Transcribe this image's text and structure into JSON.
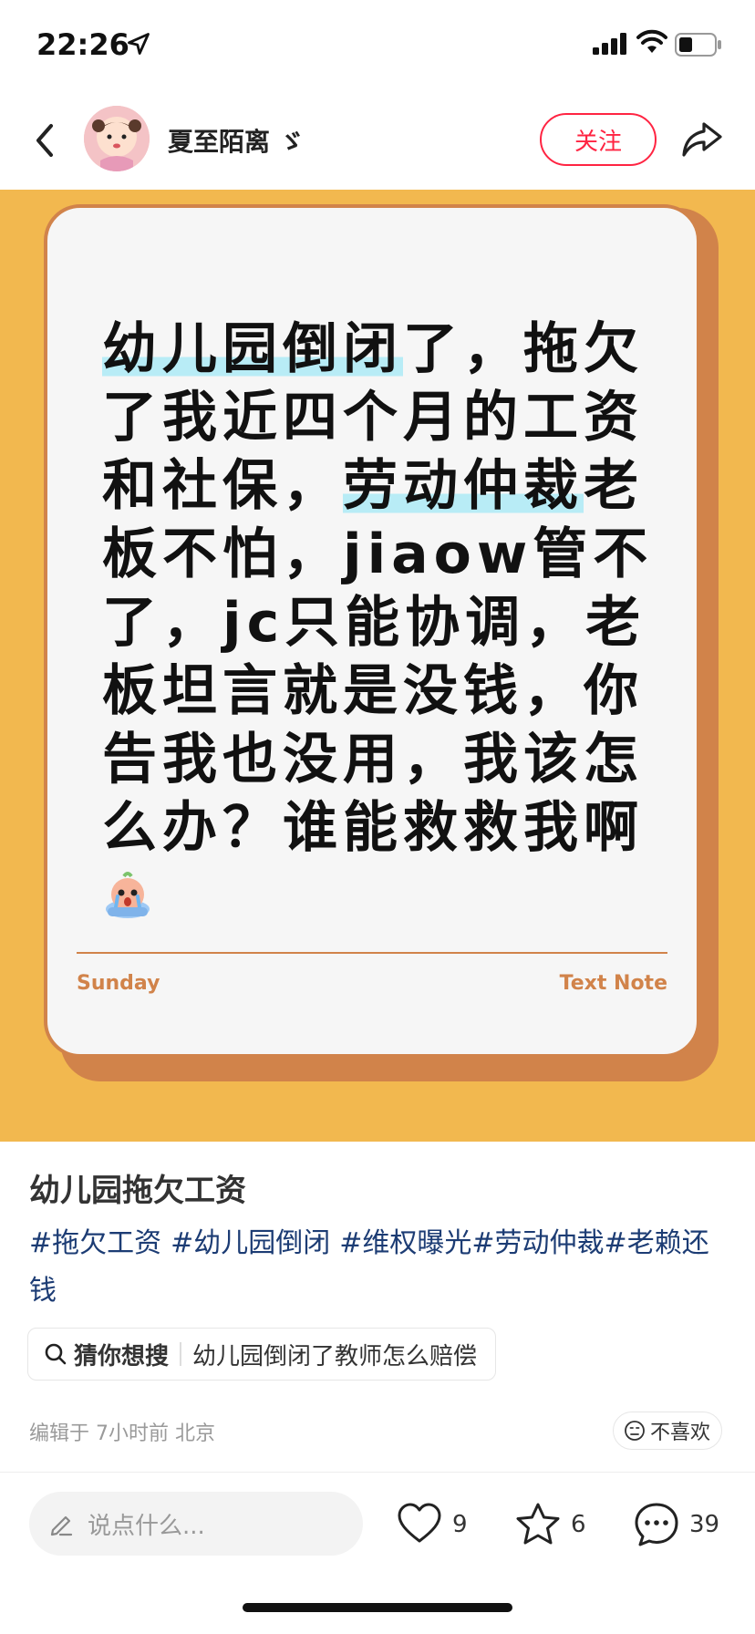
{
  "status_bar": {
    "time": "22:26"
  },
  "header": {
    "username": "夏至陌离 ゞ",
    "follow_label": "关注"
  },
  "note_card": {
    "text_parts": {
      "p1": "幼儿园倒闭",
      "p2": "了，拖欠了我近四个月的工资和社保，",
      "p3": "劳动仲裁",
      "p4": "老板不怕，jiaow管不了，jc只能协调，老板坦言就是没钱，你告我也没用，我该怎么办？谁能救救我啊"
    },
    "day": "Sunday",
    "type": "Text Note",
    "colors": {
      "background": "#f2b84f",
      "card": "#f6f6f6",
      "accent": "#d1834a",
      "highlight": "#b8ecf6"
    }
  },
  "post": {
    "title": "幼儿园拖欠工资",
    "tags": [
      "#拖欠工资",
      "#幼儿园倒闭",
      "#维权曝光#劳动仲裁#老赖还钱"
    ],
    "search_chip": {
      "label": "猜你想搜",
      "query": "幼儿园倒闭了教师怎么赔偿"
    },
    "meta": "编辑于 7小时前 北京",
    "dislike_label": "不喜欢"
  },
  "bottom_bar": {
    "comment_placeholder": "说点什么...",
    "likes": "9",
    "stars": "6",
    "comments": "39"
  },
  "colors": {
    "brand_red": "#ff2442",
    "tag_blue": "#1c3c74"
  }
}
